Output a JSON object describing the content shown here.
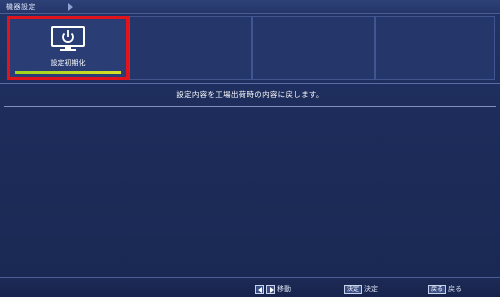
{
  "window": {
    "title": "機器設定"
  },
  "tiles": [
    {
      "label": "設定初期化",
      "icon": "power-monitor-icon",
      "selected": true,
      "progress": 1.0
    },
    {
      "label": ""
    },
    {
      "label": ""
    },
    {
      "label": ""
    }
  ],
  "message": "設定内容を工場出荷時の内容に戻します。",
  "footer": {
    "move_label": "移動",
    "enter_key": "決定",
    "enter_label": "決定",
    "back_key": "戻る",
    "back_label": "戻る"
  },
  "colors": {
    "background": "#1c2a55",
    "selection_border": "#e0141c",
    "progress": "#b6d81f"
  }
}
